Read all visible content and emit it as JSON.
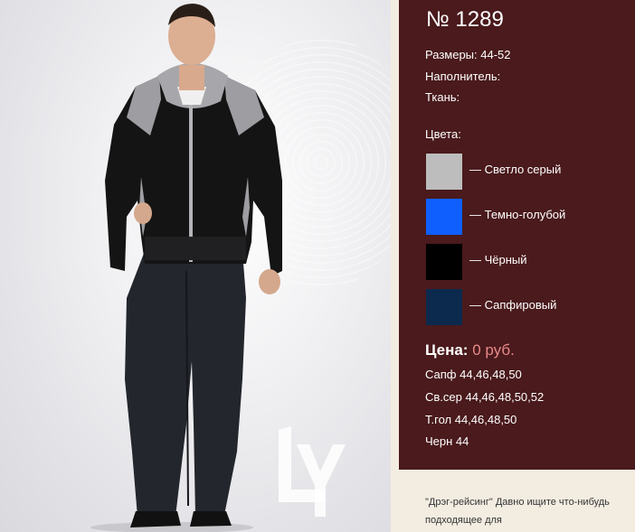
{
  "product": {
    "number": "№ 1289",
    "sizes": "Размеры: 44-52",
    "filler": "Наполнитель:",
    "fabric": "Ткань:",
    "colors_label": "Цвета:",
    "colors": [
      {
        "label": "— Светло серый",
        "hex": "#bdbdbd"
      },
      {
        "label": "— Темно-голубой",
        "hex": "#0f5ffe"
      },
      {
        "label": "— Чёрный",
        "hex": "#000000"
      },
      {
        "label": "— Сапфировый",
        "hex": "#0c2a4e"
      }
    ],
    "price_label": "Цена:",
    "price_value": "0 руб.",
    "size_lines": [
      "Сапф 44,46,48,50",
      "Св.сер 44,46,48,50,52",
      "Т.гол 44,46,48,50",
      "Черн 44"
    ]
  },
  "footer": {
    "text": "\"Дрэг-рейсинг\" Давно ищите что-нибудь подходящее для"
  },
  "theme": {
    "panel_bg": "#4a1a1c",
    "page_bg": "#f3ece1",
    "price_color": "#e8898a"
  }
}
